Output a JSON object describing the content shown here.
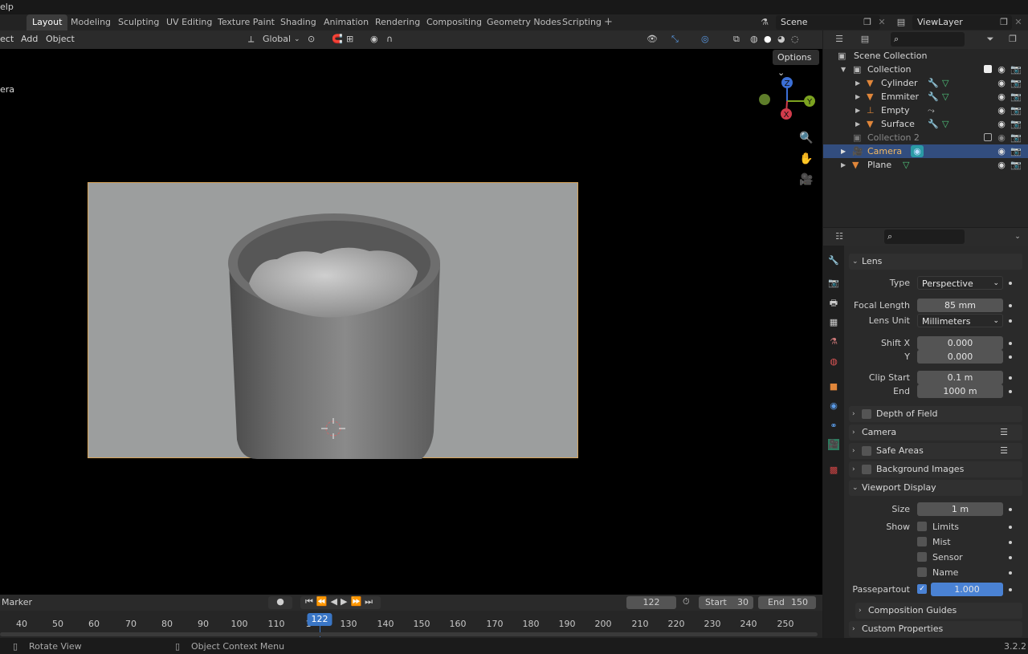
{
  "topbar": {
    "help_partial": "elp"
  },
  "workspaces": {
    "tabs": [
      "Layout",
      "Modeling",
      "Sculpting",
      "UV Editing",
      "Texture Paint",
      "Shading",
      "Animation",
      "Rendering",
      "Compositing",
      "Geometry Nodes",
      "Scripting"
    ],
    "active": "Layout",
    "add": "+"
  },
  "scene": {
    "name": "Scene",
    "view_layer": "ViewLayer"
  },
  "viewport_header": {
    "menus": [
      "ect",
      "Add",
      "Object"
    ],
    "orientation": "Global",
    "options": "Options"
  },
  "viewport": {
    "camera_label": "era"
  },
  "gizmo": {
    "z": "Z",
    "y": "Y",
    "x": "X"
  },
  "outliner": {
    "rows": [
      {
        "label": "Scene Collection"
      },
      {
        "label": "Collection"
      },
      {
        "label": "Cylinder"
      },
      {
        "label": "Emmiter"
      },
      {
        "label": "Empty"
      },
      {
        "label": "Surface"
      },
      {
        "label": "Collection 2"
      },
      {
        "label": "Camera"
      },
      {
        "label": "Plane"
      }
    ]
  },
  "properties": {
    "lens_panel": "Lens",
    "type_label": "Type",
    "type_value": "Perspective",
    "focal_label": "Focal Length",
    "focal_value": "85 mm",
    "lens_unit_label": "Lens Unit",
    "lens_unit_value": "Millimeters",
    "shiftx_label": "Shift X",
    "shiftx_value": "0.000",
    "shifty_label": "Y",
    "shifty_value": "0.000",
    "clipstart_label": "Clip Start",
    "clipstart_value": "0.1 m",
    "clipend_label": "End",
    "clipend_value": "1000 m",
    "dof_panel": "Depth of Field",
    "camera_panel": "Camera",
    "safe_panel": "Safe Areas",
    "bg_panel": "Background Images",
    "vd_panel": "Viewport Display",
    "size_label": "Size",
    "size_value": "1 m",
    "show_label": "Show",
    "limits": "Limits",
    "mist": "Mist",
    "sensor": "Sensor",
    "name": "Name",
    "passepartout_label": "Passepartout",
    "passepartout_value": "1.000",
    "comp_guides": "Composition Guides",
    "custom_props": "Custom Properties"
  },
  "timeline": {
    "marker": "Marker",
    "current_frame": "122",
    "start_label": "Start",
    "start_value": "30",
    "end_label": "End",
    "end_value": "150",
    "ticks": [
      "40",
      "50",
      "60",
      "70",
      "80",
      "90",
      "100",
      "110",
      "1",
      "130",
      "140",
      "150",
      "160",
      "170",
      "180",
      "190",
      "200",
      "210",
      "220",
      "230",
      "240",
      "250"
    ],
    "frame_badge": "122"
  },
  "status": {
    "rotate": "Rotate View",
    "context": "Object Context Menu",
    "version": "3.2.2"
  },
  "colors": {
    "accent": "#3a76c6",
    "selected_row": "#324d7e",
    "camera_border": "#d8a55a"
  }
}
